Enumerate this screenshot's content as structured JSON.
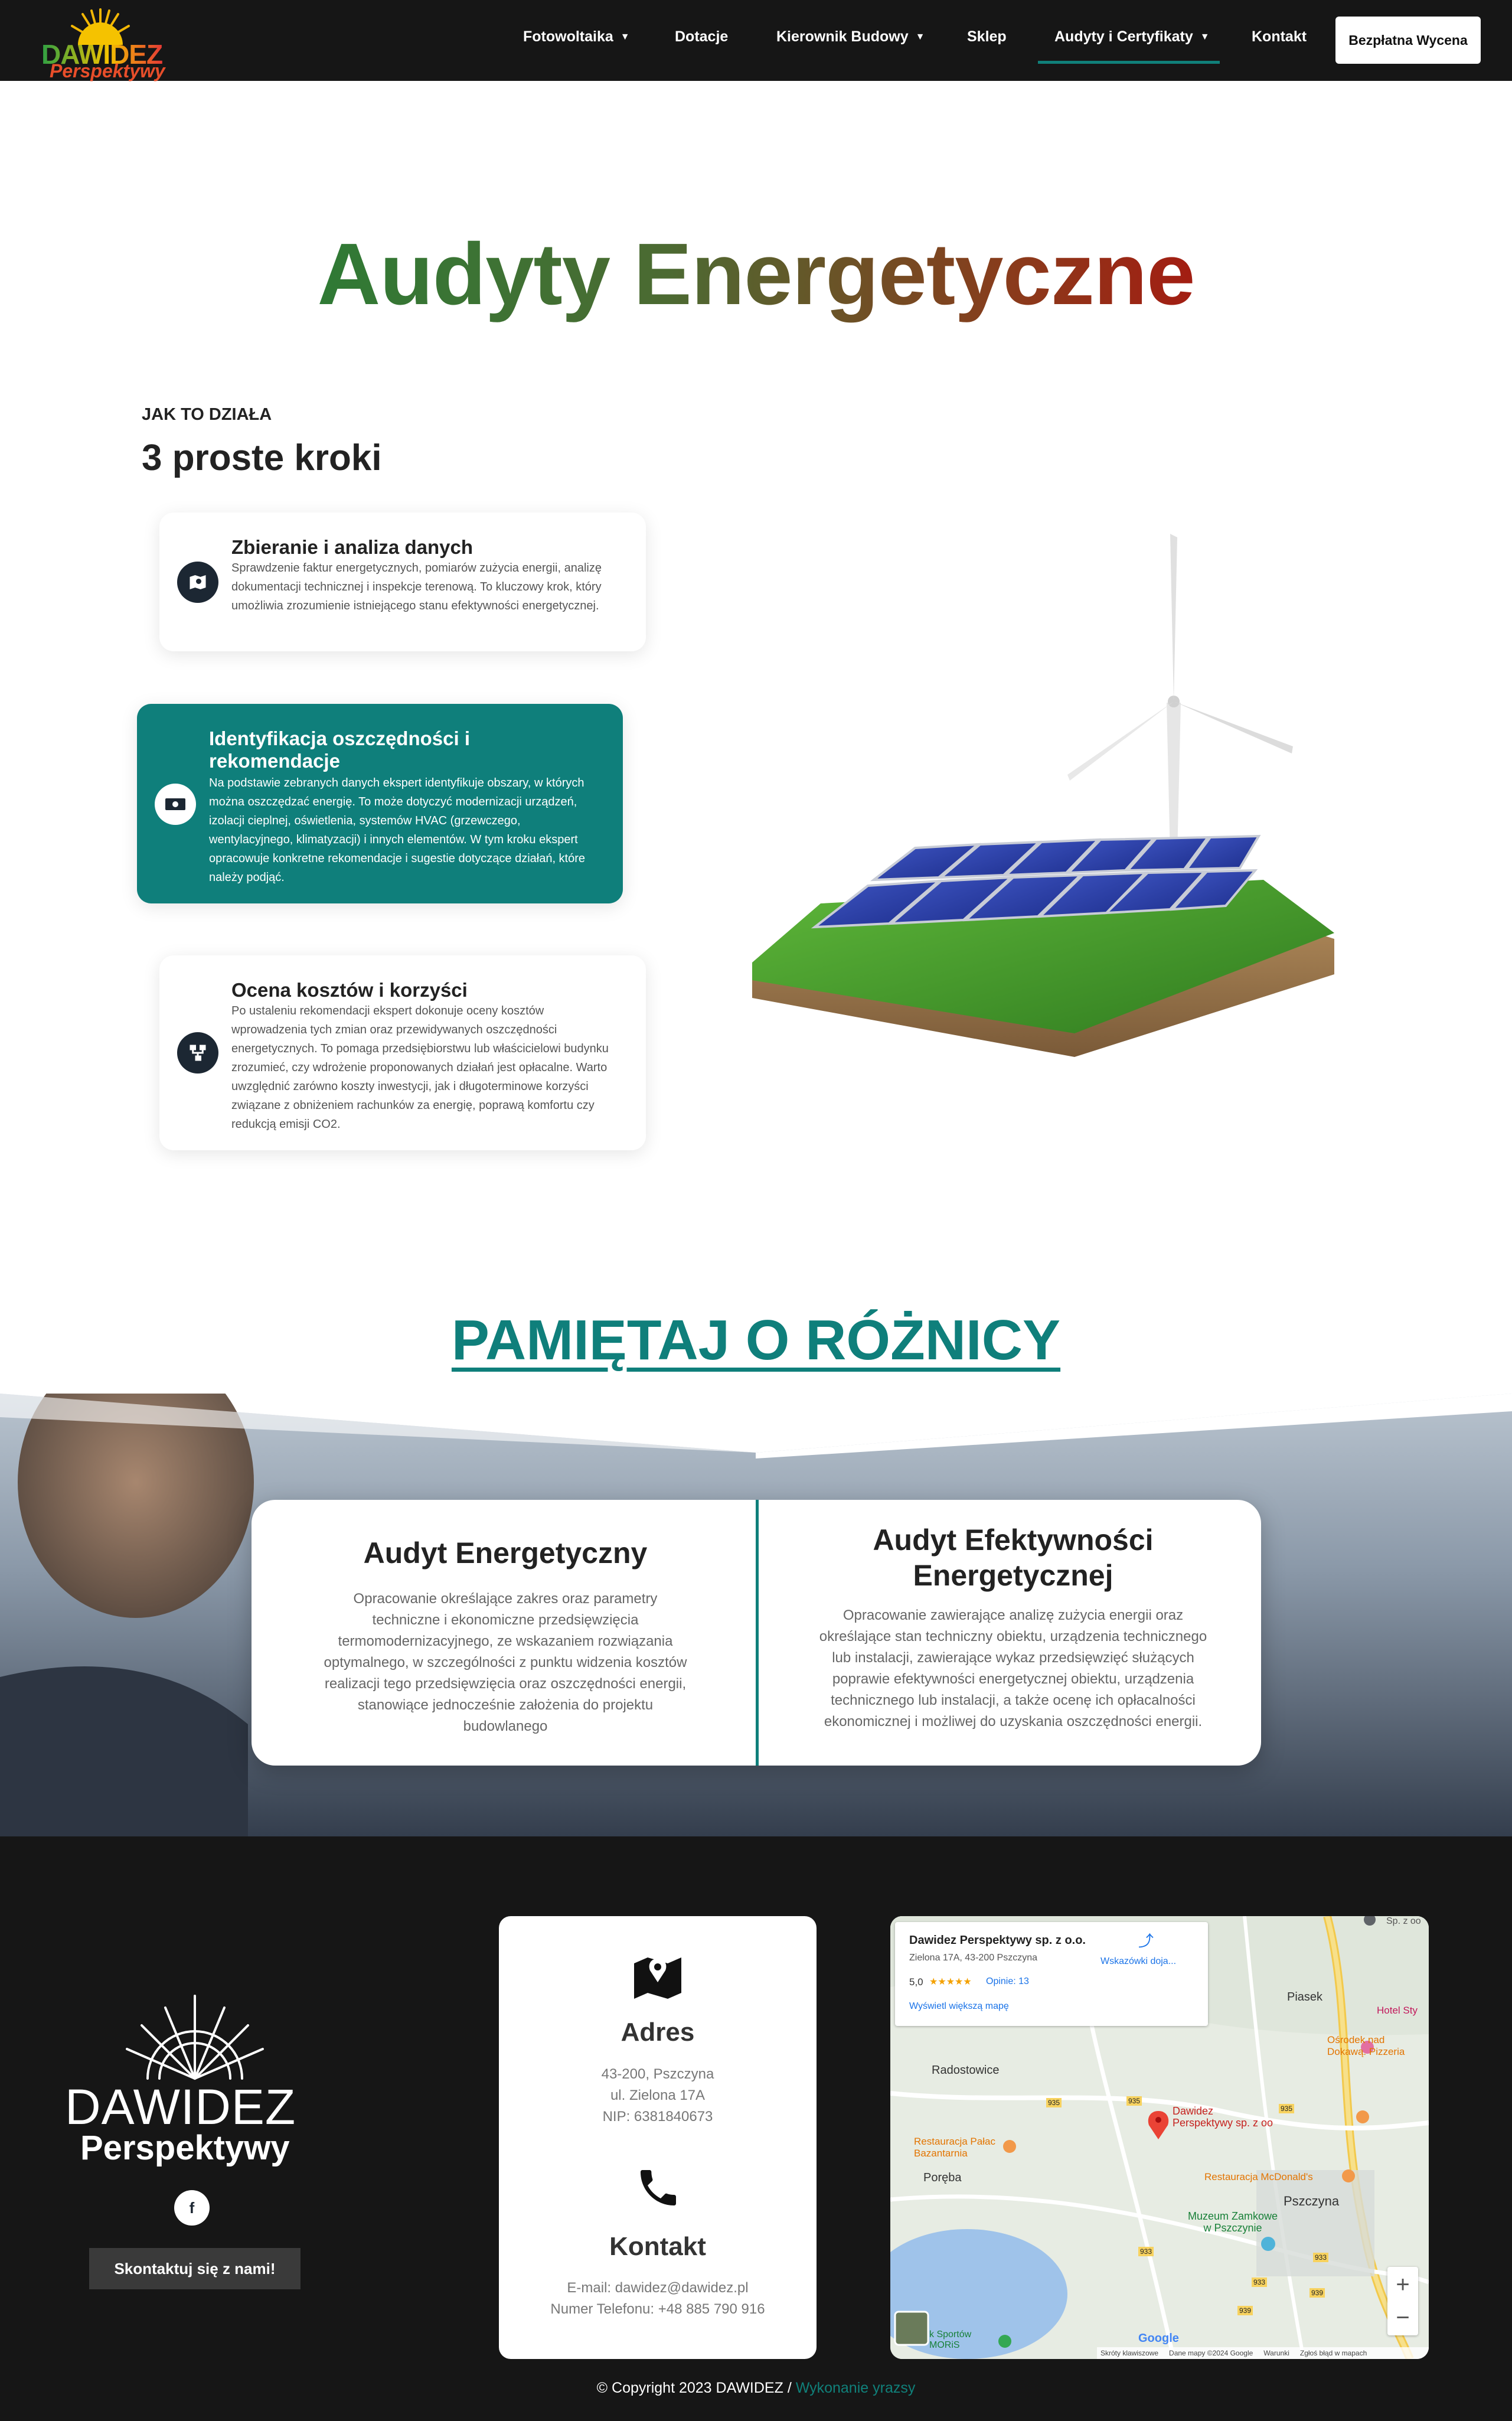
{
  "header": {
    "logo": {
      "line1": "DAWIDEZ",
      "line2": "Perspektywy"
    },
    "nav": [
      {
        "label": "Fotowoltaika",
        "has_dropdown": true
      },
      {
        "label": "Dotacje",
        "has_dropdown": false
      },
      {
        "label": "Kierownik Budowy",
        "has_dropdown": true
      },
      {
        "label": "Sklep",
        "has_dropdown": false
      },
      {
        "label": "Audyty i Certyfikaty",
        "has_dropdown": true,
        "active": true
      },
      {
        "label": "Kontakt",
        "has_dropdown": false
      }
    ],
    "cta_label": "Bezpłatna Wycena",
    "accent_color": "#10807a"
  },
  "hero": {
    "title": "Audyty Energetyczne"
  },
  "how": {
    "kicker": "JAK TO DZIAŁA",
    "title": "3 proste kroki",
    "steps": [
      {
        "icon": "map-analysis-icon",
        "title": "Zbieranie i analiza danych",
        "text": "Sprawdzenie faktur energetycznych, pomiarów zużycia energii, analizę dokumentacji technicznej i inspekcje terenową. To kluczowy krok, który umożliwia zrozumienie istniejącego stanu efektywności energetycznej."
      },
      {
        "icon": "money-icon",
        "title": "Identyfikacja oszczędności i rekomendacje",
        "text": "Na podstawie zebranych danych ekspert identyfikuje obszary, w których można oszczędzać energię. To może dotyczyć modernizacji urządzeń, izolacji cieplnej, oświetlenia, systemów HVAC (grzewczego, wentylacyjnego, klimatyzacji) i innych elementów. W tym kroku ekspert opracowuje konkretne rekomendacje i sugestie dotyczące działań, które należy podjąć."
      },
      {
        "icon": "network-icon",
        "title": "Ocena kosztów i korzyści",
        "text": "Po ustaleniu rekomendacji ekspert dokonuje oceny kosztów wprowadzenia tych zmian oraz przewidywanych oszczędności energetycznych. To pomaga przedsiębiorstwu lub właścicielowi budynku zrozumieć, czy wdrożenie proponowanych działań jest opłacalne. Warto uwzględnić zarówno koszty inwestycji, jak i długoterminowe korzyści związane z obniżeniem rachunków za energię, poprawą komfortu czy redukcją emisji CO2."
      }
    ]
  },
  "difference": {
    "title": "PAMIĘTAJ O RÓŻNICY",
    "left": {
      "title": "Audyt Energetyczny",
      "text": "Opracowanie określające zakres oraz parametry techniczne i ekonomiczne przedsięwzięcia termomodernizacyjnego, ze wskazaniem rozwiązania optymalnego, w szczególności z punktu widzenia kosztów realizacji tego przedsięwzięcia oraz oszczędności energii, stanowiące jednocześnie założenia do projektu budowlanego"
    },
    "right": {
      "title": "Audyt Efektywności Energetycznej",
      "text": "Opracowanie zawierające analizę zużycia energii oraz określające stan techniczny obiektu, urządzenia technicznego lub instalacji, zawierające wykaz przedsięwzięć służących poprawie efektywności energetycznej obiektu, urządzenia technicznego lub instalacji, a także ocenę ich opłacalności ekonomicznej i możliwej do uzyskania oszczędności energii."
    }
  },
  "footer": {
    "logo": {
      "line1": "DAWIDEZ",
      "line2": "Perspektywy"
    },
    "facebook_icon": "facebook-icon",
    "contact_button": "Skontaktuj się z nami!",
    "address": {
      "heading": "Adres",
      "lines": [
        "43-200, Pszczyna",
        "ul. Zielona 17A",
        "NIP: 6381840673"
      ]
    },
    "contact": {
      "heading": "Kontakt",
      "lines": [
        "E-mail: dawidez@dawidez.pl",
        "Numer Telefonu: +48 885 790 916"
      ]
    },
    "map": {
      "place_name": "Dawidez Perspektywy sp. z o.o.",
      "place_address": "Zielona 17A, 43-200 Pszczyna",
      "rating": "5,0",
      "stars": "★★★★★",
      "reviews": "Opinie: 13",
      "directions": "Wskazówki doja...",
      "bigger_map": "Wyświetl większą mapę",
      "pin_label_1": "Dawidez",
      "pin_label_2": "Perspektywy sp. z oo",
      "places": [
        "Piasek",
        "Radostowice",
        "Poręba",
        "Pszczyna",
        "Hotel Sty",
        "Ośrodek nad",
        "Dokawą. Pizzeria",
        "Restauracja Pałac",
        "Bazantarnia",
        "Restauracja McDonald's",
        "Muzeum Zamkowe",
        "w Pszczynie",
        "Sp. z oo",
        "k Sportów",
        "MORiS"
      ],
      "roads": [
        "935",
        "935",
        "935",
        "933",
        "933",
        "939",
        "933",
        "939"
      ],
      "attribution": [
        "Skróty klawiszowe",
        "Dane mapy ©2024 Google",
        "Warunki",
        "Zgłoś błąd w mapach"
      ],
      "google": "Google",
      "zoom_in": "+",
      "zoom_out": "−"
    },
    "copyright": "© Copyright 2023 DAWIDEZ / ",
    "credit": "Wykonanie yrazsy"
  }
}
